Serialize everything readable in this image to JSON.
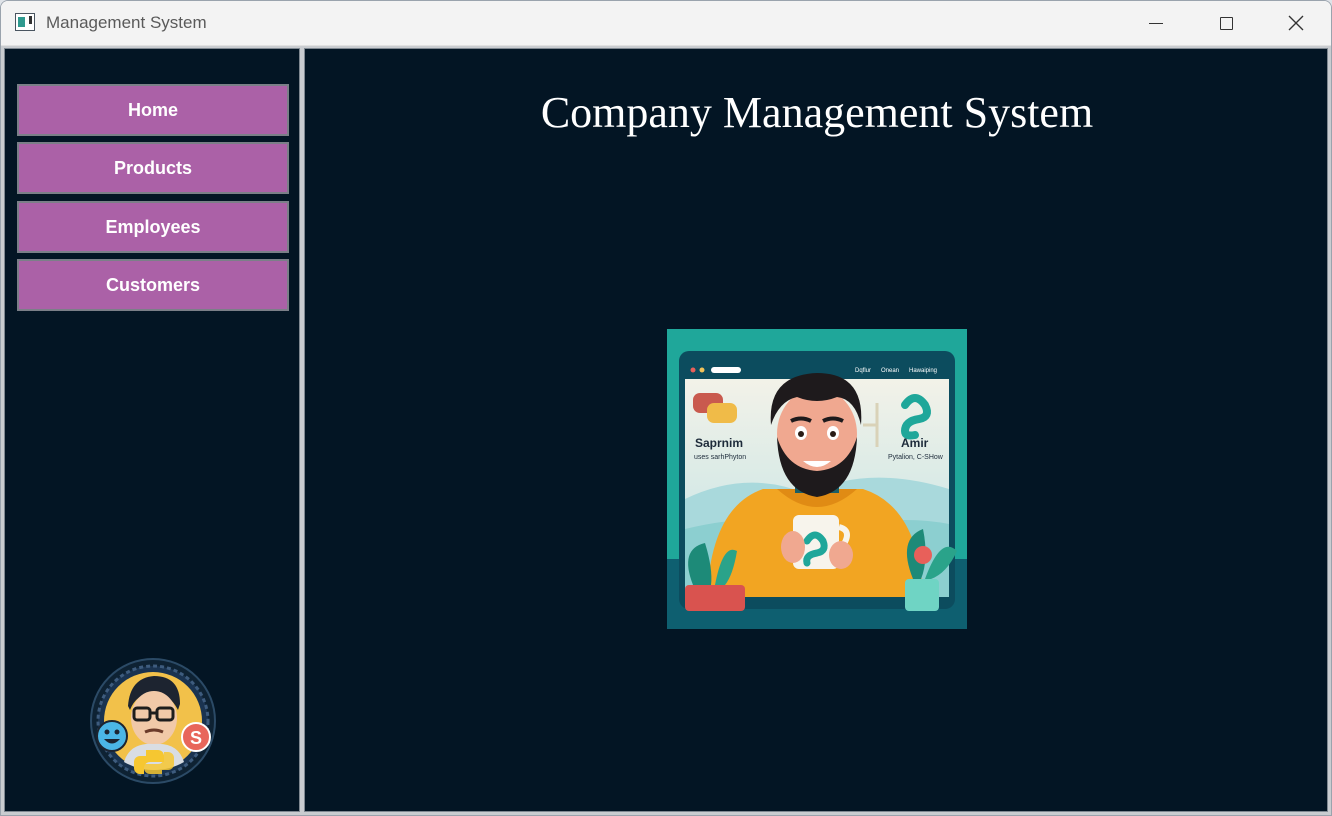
{
  "window": {
    "title": "Management System",
    "controls": [
      "minimize-icon",
      "maximize-icon",
      "close-icon"
    ]
  },
  "sidebar": {
    "items": [
      {
        "label": "Home"
      },
      {
        "label": "Products"
      },
      {
        "label": "Employees"
      },
      {
        "label": "Customers"
      }
    ],
    "avatar_icon": "developer-avatar-logo"
  },
  "main": {
    "heading": "Company Management System",
    "hero": {
      "icon": "developer-illustration",
      "left_name": "Saprnim",
      "left_sub": "uses sarhPhyton",
      "right_name": "Amir",
      "right_sub": "Pytalion, C-SHow",
      "menu_items": [
        "Dqflur",
        "Onean",
        "Hawaiping"
      ]
    }
  },
  "colors": {
    "background": "#031524",
    "button": "#ab61a7",
    "button_text": "#ffffff",
    "hero_teal": "#1fa79a"
  }
}
